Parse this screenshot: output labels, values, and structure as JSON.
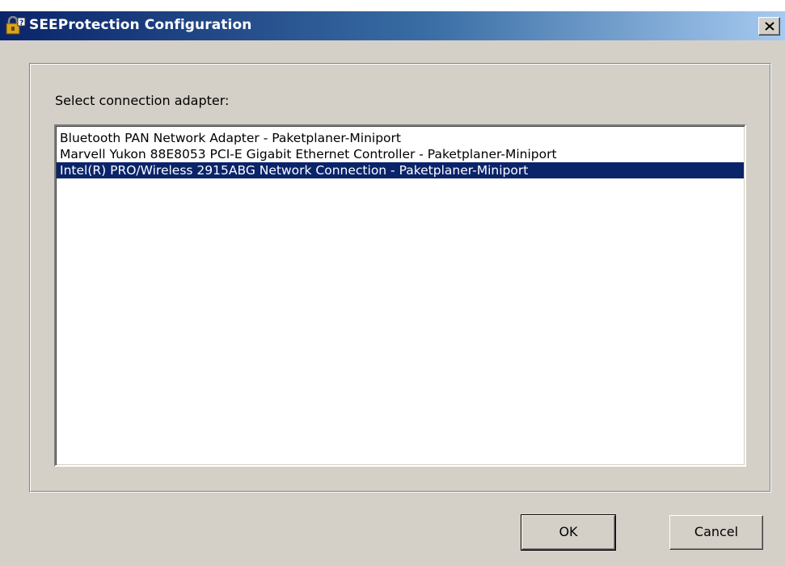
{
  "window": {
    "title": "SEEProtection Configuration",
    "icon": "lock-config-icon"
  },
  "titlebar": {
    "close_glyph": "×"
  },
  "dialog": {
    "prompt_label": "Select connection adapter:",
    "adapters": [
      {
        "label": "Bluetooth PAN Network Adapter - Paketplaner-Miniport",
        "selected": false
      },
      {
        "label": "Marvell Yukon 88E8053 PCI-E Gigabit Ethernet Controller - Paketplaner-Miniport",
        "selected": false
      },
      {
        "label": "Intel(R) PRO/Wireless 2915ABG Network Connection - Paketplaner-Miniport",
        "selected": true
      }
    ],
    "selected_index": 2
  },
  "buttons": {
    "ok_label": "OK",
    "cancel_label": "Cancel"
  },
  "colors": {
    "selection": "#0a246a",
    "dialog_face": "#d4d0c8",
    "title_start": "#0a246a",
    "title_end": "#a6caf0"
  }
}
